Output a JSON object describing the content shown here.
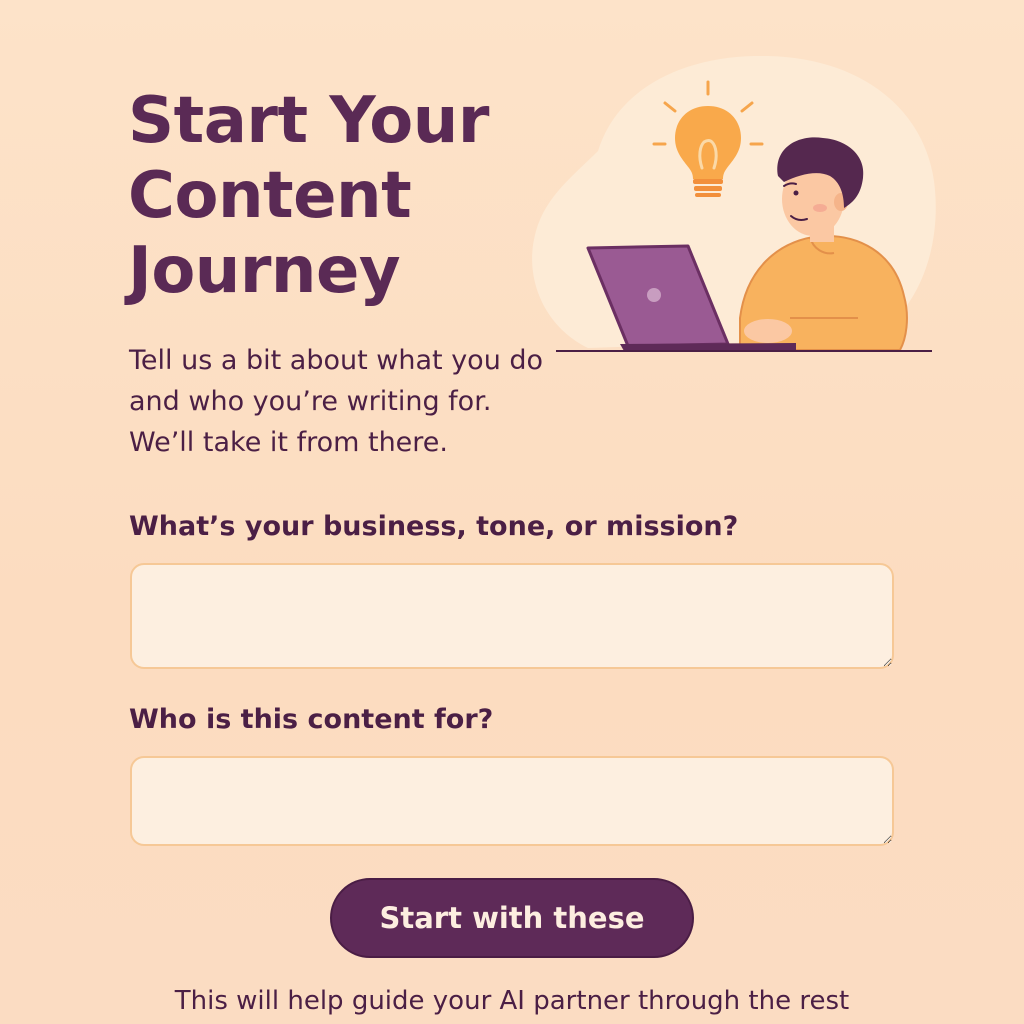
{
  "header": {
    "title": "Start Your Content Journey",
    "subtitle": "Tell us a bit about what you do and who you’re writing for. We’ll take it from there."
  },
  "illustration": {
    "icons": [
      "lightbulb-icon",
      "person-at-laptop-illustration"
    ]
  },
  "form": {
    "business_field": {
      "label": "What’s your business, tone, or mission?",
      "value": "",
      "placeholder": ""
    },
    "audience_field": {
      "label": "Who is this content for?",
      "value": "",
      "placeholder": ""
    },
    "submit_label": "Start with these"
  },
  "footer": {
    "note": "This will help guide your AI partner through the rest"
  },
  "colors": {
    "background": "#fde3c9",
    "accent": "#5e2a58",
    "heading": "#5a2a55",
    "field_border": "#f6c896",
    "field_fill": "#fdefe0",
    "bulb": "#f9a94b",
    "shirt": "#f8b25e",
    "laptop": "#9a5a93"
  }
}
